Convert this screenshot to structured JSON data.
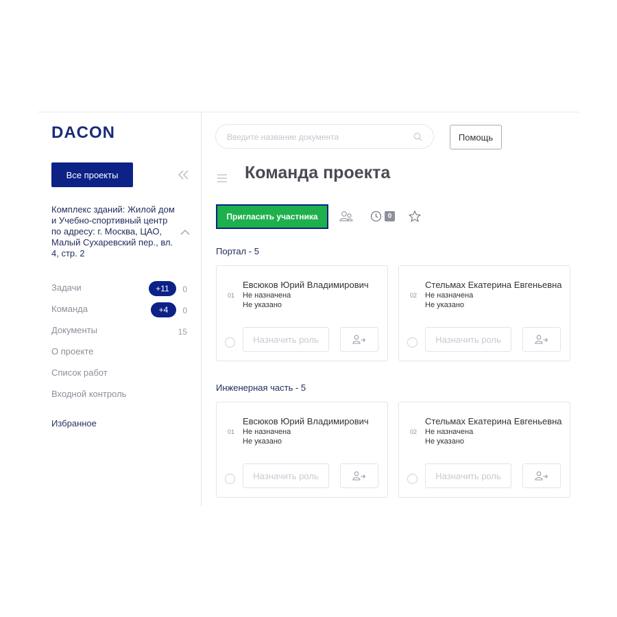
{
  "brand": {
    "logo_text": "DACON",
    "accent": "#0c2287",
    "invite_color": "#1db04c"
  },
  "sidebar": {
    "all_projects_label": "Все проекты",
    "project_name": "Комплекс зданий: Жилой дом и Учебно-спортивный центр по адресу: г. Москва, ЦАО, Малый Сухаревский пер., вл. 4, стр. 2",
    "items": [
      {
        "label": "Задачи",
        "badge": "+11",
        "count": "0"
      },
      {
        "label": "Команда",
        "badge": "+4",
        "count": "0"
      },
      {
        "label": "Документы",
        "badge": "",
        "count": "15"
      },
      {
        "label": "О проекте",
        "badge": "",
        "count": ""
      },
      {
        "label": "Список работ",
        "badge": "",
        "count": ""
      },
      {
        "label": "Входной контроль",
        "badge": "",
        "count": ""
      }
    ],
    "favorites_label": "Избранное"
  },
  "header": {
    "search_placeholder": "Введите название документа",
    "help_label": "Помощь"
  },
  "main": {
    "title": "Команда проекта",
    "invite_label": "Пригласить участника",
    "history_count": "0",
    "sections": [
      {
        "title": "Портал - 5",
        "members": [
          {
            "num": "01",
            "name": "Евсюков Юрий Владимирович",
            "role": "Не назначена",
            "info": "Не указано",
            "role_button": "Назначить роль"
          },
          {
            "num": "02",
            "name": "Стельмах Екатерина Евгеньевна",
            "role": "Не назначена",
            "info": "Не указано",
            "role_button": "Назначить роль"
          }
        ]
      },
      {
        "title": "Инженерная часть - 5",
        "members": [
          {
            "num": "01",
            "name": "Евсюков Юрий Владимирович",
            "role": "Не назначена",
            "info": "Не указано",
            "role_button": "Назначить роль"
          },
          {
            "num": "02",
            "name": "Стельмах Екатерина Евгеньевна",
            "role": "Не назначена",
            "info": "Не указано",
            "role_button": "Назначить роль"
          }
        ]
      }
    ]
  }
}
